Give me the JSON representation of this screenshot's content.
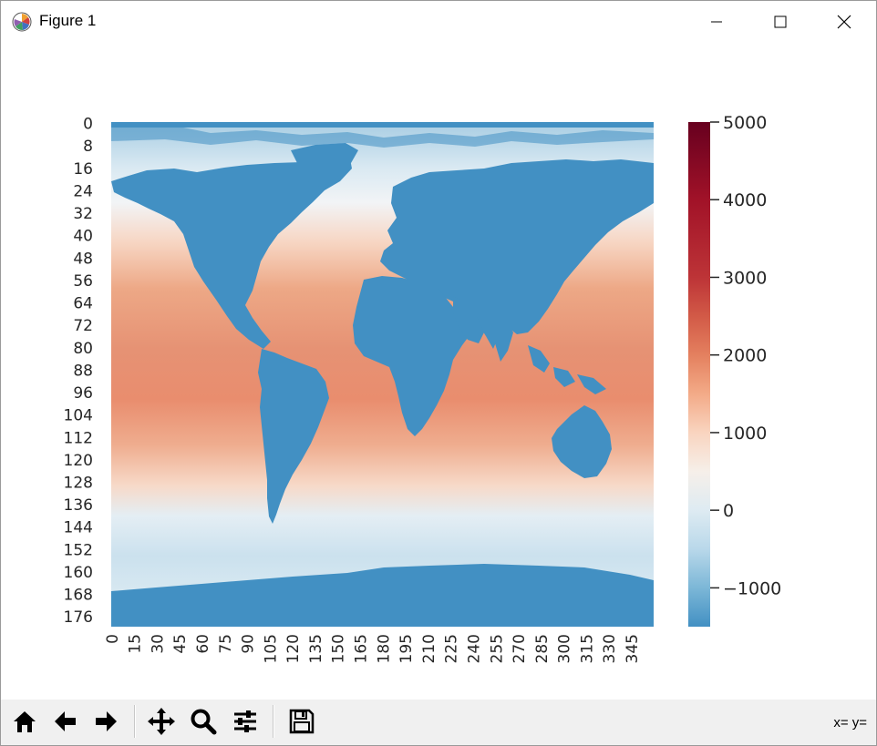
{
  "window": {
    "title": "Figure 1",
    "app_icon": "matplotlib-logo-icon",
    "controls": [
      "minimize-icon",
      "maximize-icon",
      "close-icon"
    ]
  },
  "chart_data": {
    "type": "heatmap",
    "title": "",
    "xlabel": "",
    "ylabel": "",
    "colormap": "RdBu_r",
    "value_range": [
      -1500,
      5000
    ],
    "y_ticks": [
      "0",
      "8",
      "16",
      "24",
      "32",
      "40",
      "48",
      "56",
      "64",
      "72",
      "80",
      "88",
      "96",
      "104",
      "112",
      "120",
      "128",
      "136",
      "144",
      "152",
      "160",
      "168",
      "176"
    ],
    "x_ticks": [
      "0",
      "15",
      "30",
      "45",
      "60",
      "75",
      "90",
      "105",
      "120",
      "135",
      "150",
      "165",
      "180",
      "195",
      "210",
      "225",
      "240",
      "255",
      "270",
      "285",
      "300",
      "315",
      "330",
      "345"
    ],
    "colorbar": {
      "ticks": [
        5000,
        4000,
        3000,
        2000,
        1000,
        0,
        -1000
      ],
      "tick_labels": [
        "5000",
        "4000",
        "3000",
        "2000",
        "1000",
        "0",
        "−1000"
      ],
      "range": [
        -1500,
        5000
      ]
    },
    "land_value_approx": -1300,
    "description_of_field": "ocean values: equatorial ~2500-3000, mid-latitude ~1500-2000, polar ~0 to -500"
  },
  "toolbar": {
    "buttons": [
      {
        "name": "home-icon"
      },
      {
        "name": "back-arrow-icon"
      },
      {
        "name": "forward-arrow-icon"
      },
      {
        "name": "pan-icon"
      },
      {
        "name": "zoom-icon"
      },
      {
        "name": "configure-subplots-icon"
      },
      {
        "name": "save-icon"
      }
    ],
    "coords_text": "x= y="
  },
  "colors": {
    "land": "#4290c3",
    "titlebar_bg": "#ffffff",
    "toolbar_bg": "#f0f0f0"
  }
}
